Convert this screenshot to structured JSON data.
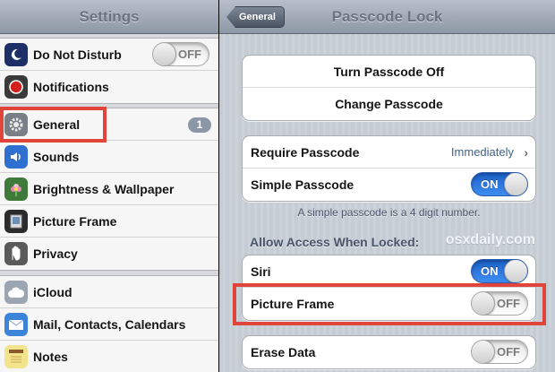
{
  "settings": {
    "title": "Settings",
    "groups": [
      {
        "items": [
          {
            "label": "Do Not Disturb",
            "icon": "moon-icon",
            "toggle": "OFF"
          },
          {
            "label": "Notifications",
            "icon": "notifications-icon"
          }
        ]
      },
      {
        "items": [
          {
            "label": "General",
            "icon": "gear-icon",
            "badge": "1"
          },
          {
            "label": "Sounds",
            "icon": "speaker-icon"
          },
          {
            "label": "Brightness & Wallpaper",
            "icon": "flower-icon"
          },
          {
            "label": "Picture Frame",
            "icon": "picture-frame-icon"
          },
          {
            "label": "Privacy",
            "icon": "hand-icon"
          }
        ]
      },
      {
        "items": [
          {
            "label": "iCloud",
            "icon": "cloud-icon"
          },
          {
            "label": "Mail, Contacts, Calendars",
            "icon": "mail-icon"
          },
          {
            "label": "Notes",
            "icon": "notes-icon"
          }
        ]
      }
    ]
  },
  "passcode": {
    "title": "Passcode Lock",
    "back_label": "General",
    "turn_off": "Turn Passcode Off",
    "change": "Change Passcode",
    "require_label": "Require Passcode",
    "require_value": "Immediately",
    "simple_label": "Simple Passcode",
    "simple_toggle": "ON",
    "simple_note": "A simple passcode is a 4 digit number.",
    "allow_header": "Allow Access When Locked:",
    "watermark": "osxdaily.com",
    "siri_label": "Siri",
    "siri_toggle": "ON",
    "picture_frame_label": "Picture Frame",
    "picture_frame_toggle": "OFF",
    "erase_label": "Erase Data",
    "erase_toggle": "OFF"
  },
  "colors": {
    "highlight": "#e0443b",
    "toggle_on": "#2f7be6",
    "badge": "#8b96a6"
  }
}
